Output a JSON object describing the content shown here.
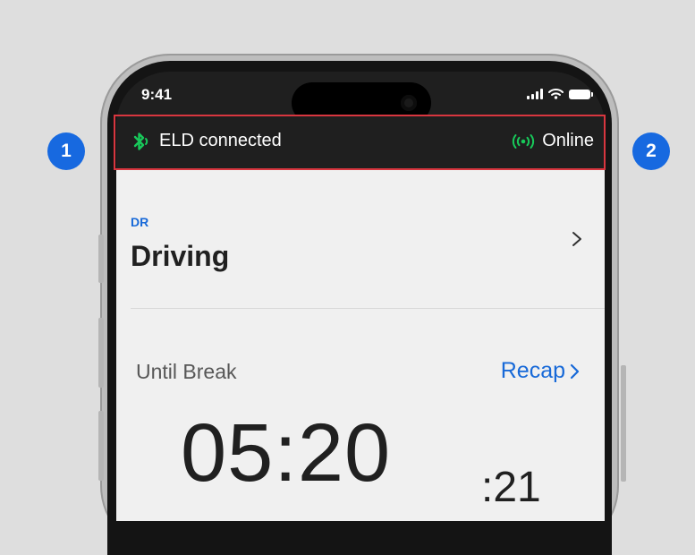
{
  "status_bar": {
    "time": "9:41"
  },
  "connection_bar": {
    "eld_text": "ELD connected",
    "online_text": "Online"
  },
  "duty_status": {
    "code": "DR",
    "label": "Driving"
  },
  "break_timer": {
    "label": "Until Break",
    "recap_label": "Recap",
    "time_main": "05:20",
    "time_seconds": ":21"
  },
  "callouts": {
    "marker_1": "1",
    "marker_2": "2"
  },
  "colors": {
    "accent_blue": "#1769d8",
    "connection_green": "#18c95a",
    "highlight_red": "#d8363f",
    "dark_bar": "#1f1f1f",
    "content_bg": "#f0f0f0"
  },
  "icons": {
    "bluetooth": "bluetooth-icon",
    "online": "online-signal-icon",
    "chevron": "chevron-right-icon",
    "cellular": "cellular-signal-icon",
    "wifi": "wifi-icon",
    "battery": "battery-icon"
  }
}
